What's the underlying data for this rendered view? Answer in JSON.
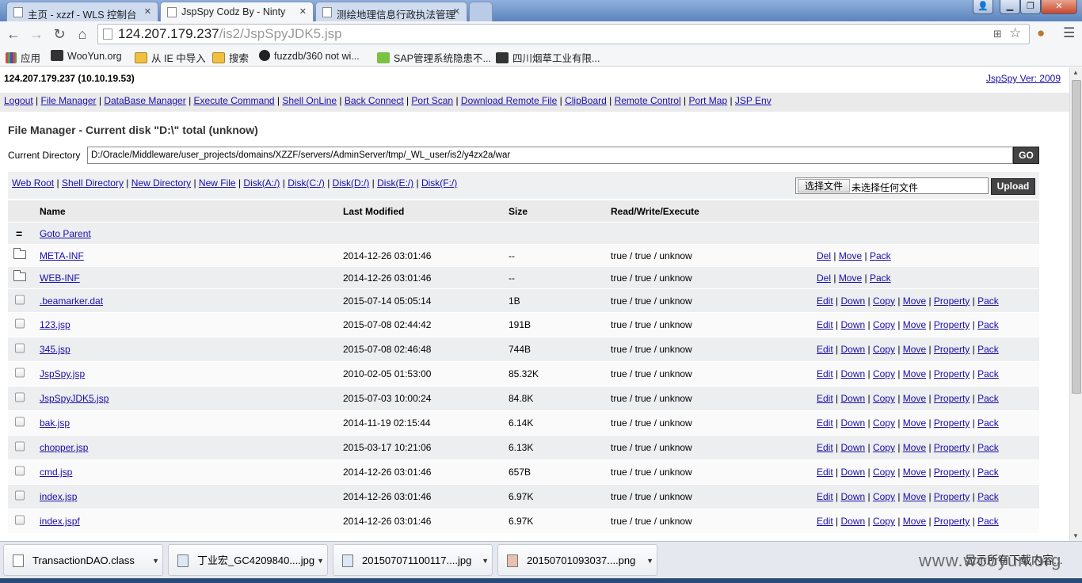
{
  "browser": {
    "tabs": [
      {
        "title": "主页 - xzzf - WLS 控制台"
      },
      {
        "title": "JspSpy Codz By - Ninty"
      },
      {
        "title": "测绘地理信息行政执法管理"
      }
    ],
    "url_host": "124.207.179.237",
    "url_path": "/is2/JspSpyJDK5.jsp",
    "bookmarks": [
      "应用",
      "WooYun.org",
      "从 IE 中导入",
      "搜索",
      "fuzzdb/360 not wi...",
      "SAP管理系统隐患不...",
      "四川烟草工业有限..."
    ]
  },
  "header": {
    "ip": "124.207.179.237 (10.10.19.53)",
    "version": "JspSpy Ver: 2009"
  },
  "nav": [
    "Logout",
    "File Manager",
    "DataBase Manager",
    "Execute Command",
    "Shell OnLine",
    "Back Connect",
    "Port Scan",
    "Download Remote File",
    "ClipBoard",
    "Remote Control",
    "Port Map",
    "JSP Env"
  ],
  "file_manager": {
    "title": "File Manager - Current disk \"D:\\\" total (unknow)",
    "current_dir_label": "Current Directory",
    "current_dir": "D:/Oracle/Middleware/user_projects/domains/XZZF/servers/AdminServer/tmp/_WL_user/is2/y4zx2a/war",
    "go_label": "GO",
    "quick_links": [
      "Web Root",
      "Shell Directory",
      "New Directory",
      "New File",
      "Disk(A:/)",
      "Disk(C:/)",
      "Disk(D:/)",
      "Disk(E:/)",
      "Disk(F:/)"
    ],
    "choose_file_label": "选择文件",
    "no_file_label": "未选择任何文件",
    "upload_label": "Upload",
    "columns": [
      "Name",
      "Last Modified",
      "Size",
      "Read/Write/Execute"
    ],
    "parent_symbol": "=",
    "parent_label": "Goto Parent",
    "folders": [
      {
        "name": "META-INF",
        "modified": "2014-12-26 03:01:46",
        "size": "--",
        "rwx": "true / true / unknow"
      },
      {
        "name": "WEB-INF",
        "modified": "2014-12-26 03:01:46",
        "size": "--",
        "rwx": "true / true / unknow"
      }
    ],
    "folder_actions": [
      "Del",
      "Move",
      "Pack"
    ],
    "files": [
      {
        "name": ".beamarker.dat",
        "modified": "2015-07-14 05:05:14",
        "size": "1B",
        "rwx": "true / true / unknow"
      },
      {
        "name": "123.jsp",
        "modified": "2015-07-08 02:44:42",
        "size": "191B",
        "rwx": "true / true / unknow"
      },
      {
        "name": "345.jsp",
        "modified": "2015-07-08 02:46:48",
        "size": "744B",
        "rwx": "true / true / unknow"
      },
      {
        "name": "JspSpy.jsp",
        "modified": "2010-02-05 01:53:00",
        "size": "85.32K",
        "rwx": "true / true / unknow"
      },
      {
        "name": "JspSpyJDK5.jsp",
        "modified": "2015-07-03 10:00:24",
        "size": "84.8K",
        "rwx": "true / true / unknow"
      },
      {
        "name": "bak.jsp",
        "modified": "2014-11-19 02:15:44",
        "size": "6.14K",
        "rwx": "true / true / unknow"
      },
      {
        "name": "chopper.jsp",
        "modified": "2015-03-17 10:21:06",
        "size": "6.13K",
        "rwx": "true / true / unknow"
      },
      {
        "name": "cmd.jsp",
        "modified": "2014-12-26 03:01:46",
        "size": "657B",
        "rwx": "true / true / unknow"
      },
      {
        "name": "index.jsp",
        "modified": "2014-12-26 03:01:46",
        "size": "6.97K",
        "rwx": "true / true / unknow"
      },
      {
        "name": "index.jspf",
        "modified": "2014-12-26 03:01:46",
        "size": "6.97K",
        "rwx": "true / true / unknow"
      }
    ],
    "file_actions": [
      "Edit",
      "Down",
      "Copy",
      "Move",
      "Property",
      "Pack"
    ]
  },
  "downloads": {
    "items": [
      "TransactionDAO.class",
      "丁业宏_GC4209840....jpg",
      "201507071100117....jpg",
      "20150701093037....png"
    ],
    "show_all": "显示所有下载内容..."
  },
  "watermark": "www.wooyun.org",
  "colors": {
    "link": "#1a0dab",
    "button_dark": "#444444",
    "row_alt": "#eceeef",
    "header_bg": "#eaeaea"
  }
}
